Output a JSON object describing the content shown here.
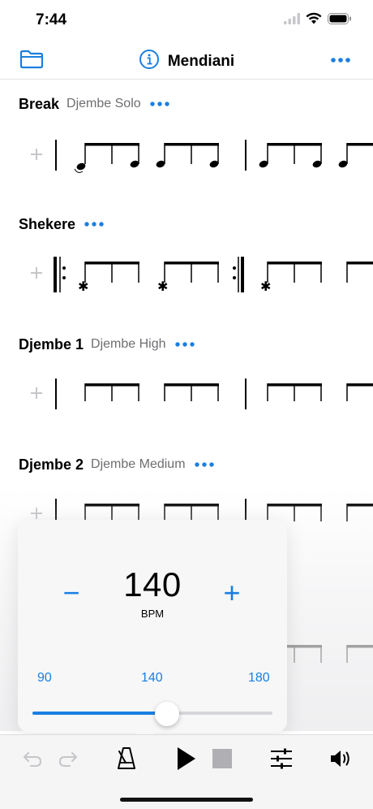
{
  "status_bar": {
    "time": "7:44"
  },
  "nav": {
    "title": "Mendiani"
  },
  "tracks": [
    {
      "name": "Break",
      "instrument": "Djembe Solo"
    },
    {
      "name": "Shekere",
      "instrument": ""
    },
    {
      "name": "Djembe 1",
      "instrument": "Djembe High"
    },
    {
      "name": "Djembe 2",
      "instrument": "Djembe Medium"
    }
  ],
  "tempo": {
    "value": "140",
    "unit": "BPM",
    "minus_label": "−",
    "plus_label": "+",
    "scale_min": "90",
    "scale_mid": "140",
    "scale_max": "180",
    "slider_fraction": 0.56
  },
  "icons": {
    "folder": "folder-icon",
    "info": "info-icon",
    "more": "more-icon",
    "undo": "undo-icon",
    "redo": "redo-icon",
    "metronome": "metronome-icon",
    "play": "play-icon",
    "stop": "stop-icon",
    "mixer": "mixer-icon",
    "volume": "volume-icon"
  },
  "colors": {
    "accent": "#1a7fe0",
    "disabled": "#c6c6ca"
  }
}
